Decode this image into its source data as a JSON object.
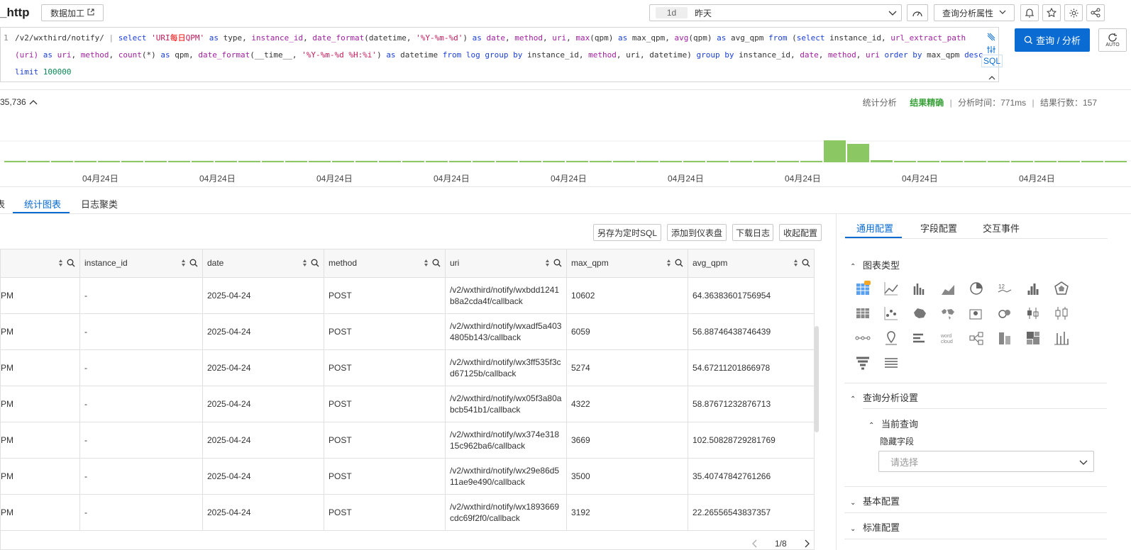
{
  "header": {
    "title": "_http",
    "data_process_btn": "数据加工",
    "time_tag": "1d",
    "time_label": "昨天",
    "query_props_btn": "查询分析属性",
    "auto_label": "AUTO"
  },
  "editor": {
    "line_number": "1",
    "query_btn": "查询 / 分析",
    "sql_label": "SQL"
  },
  "histogram": {
    "count": "35,736",
    "stat_label": "统计分析",
    "result_exact": "结果精确",
    "analysis_time": "分析时间：771ms",
    "result_rows": "结果行数：157",
    "x_ticks": [
      "04月24日",
      "04月24日",
      "04月24日",
      "04月24日",
      "04月24日",
      "04月24日",
      "04月24日",
      "04月24日",
      "04月24日"
    ],
    "colors": {
      "bar": "#8bc863"
    }
  },
  "tabs": {
    "partial": "表",
    "stats_chart": "统计图表",
    "log_cluster": "日志聚类"
  },
  "toolbar": {
    "save_sql": "另存为定时SQL",
    "add_dashboard": "添加到仪表盘",
    "download_log": "下载日志",
    "collapse_config": "收起配置"
  },
  "table": {
    "columns": [
      "",
      "instance_id",
      "date",
      "method",
      "uri",
      "max_qpm",
      "avg_qpm"
    ],
    "rows": [
      {
        "type": "PM",
        "instance_id": "-",
        "date": "2025-04-24",
        "method": "POST",
        "uri": "/v2/wxthird/notify/wxbdd1241b8a2cda4f/callback",
        "max_qpm": "10602",
        "avg_qpm": "64.36383601756954"
      },
      {
        "type": "PM",
        "instance_id": "-",
        "date": "2025-04-24",
        "method": "POST",
        "uri": "/v2/wxthird/notify/wxadf5a4034805b143/callback",
        "max_qpm": "6059",
        "avg_qpm": "56.88746438746439"
      },
      {
        "type": "PM",
        "instance_id": "-",
        "date": "2025-04-24",
        "method": "POST",
        "uri": "/v2/wxthird/notify/wx3ff535f3cd67125b/callback",
        "max_qpm": "5274",
        "avg_qpm": "54.67211201866978"
      },
      {
        "type": "PM",
        "instance_id": "-",
        "date": "2025-04-24",
        "method": "POST",
        "uri": "/v2/wxthird/notify/wx05f3a80abcb541b1/callback",
        "max_qpm": "4322",
        "avg_qpm": "58.87671232876713"
      },
      {
        "type": "PM",
        "instance_id": "-",
        "date": "2025-04-24",
        "method": "POST",
        "uri": "/v2/wxthird/notify/wx374e31815c962ba6/callback",
        "max_qpm": "3669",
        "avg_qpm": "102.50828729281769"
      },
      {
        "type": "PM",
        "instance_id": "-",
        "date": "2025-04-24",
        "method": "POST",
        "uri": "/v2/wxthird/notify/wx29e86d511ae9e490/callback",
        "max_qpm": "3500",
        "avg_qpm": "35.40747842761266"
      },
      {
        "type": "PM",
        "instance_id": "-",
        "date": "2025-04-24",
        "method": "POST",
        "uri": "/v2/wxthird/notify/wx1893669cdc69f2f0/callback",
        "max_qpm": "3192",
        "avg_qpm": "22.26556543837357"
      }
    ],
    "pagination": "1/8"
  },
  "panel": {
    "tab_general": "通用配置",
    "tab_field": "字段配置",
    "tab_interact": "交互事件",
    "chart_type": "图表类型",
    "query_settings": "查询分析设置",
    "current_query": "当前查询",
    "hidden_fields": "隐藏字段",
    "select_placeholder": "请选择",
    "basic_config": "基本配置",
    "axis_config": "标准配置",
    "word_cloud": "word cloud"
  }
}
